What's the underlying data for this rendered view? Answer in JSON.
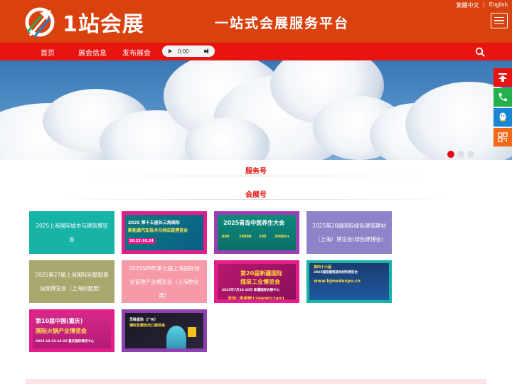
{
  "header": {
    "brand": "1站会展",
    "slogan": "一站式会展服务平台",
    "lang_traditional": "繁體中文",
    "lang_separator": "|",
    "lang_english": "English",
    "bg_color": "#d9410e"
  },
  "nav": {
    "items": [
      {
        "label": "首页"
      },
      {
        "label": "展会信息"
      },
      {
        "label": "发布展会"
      }
    ],
    "audio_time": "0:00",
    "bg_color": "#e8140f"
  },
  "banner": {
    "slide_count": 3,
    "active_slide": 1
  },
  "side_tools": [
    {
      "icon": "back-to-top-icon",
      "color": "#e8140f"
    },
    {
      "icon": "phone-icon",
      "color": "#22b14c"
    },
    {
      "icon": "qq-icon",
      "color": "#1a87d6"
    },
    {
      "icon": "qr-code-icon",
      "color": "#f26a17"
    }
  ],
  "sections": {
    "service": "服务号",
    "expo": "会展号"
  },
  "cards": [
    {
      "text": "2025上海国际城市与建筑博览会",
      "style": "teal"
    },
    {
      "image_text": [
        "2025 第十五届长三角国际",
        "新能源汽车技术与供应链博览会",
        "10.22-10.24"
      ],
      "style": "magenta-border"
    },
    {
      "image_text": [
        "2025青岛中医养生大会",
        "600",
        "20000",
        "200",
        "20000+"
      ],
      "style": "teal-image"
    },
    {
      "text": "2025第20届国际绿色建筑建材（上海）博览会(绿色建博会)",
      "style": "purple"
    },
    {
      "text": "2025第27届上海国际别墅配套设施博览会（上海别墅展）",
      "style": "olive"
    },
    {
      "text": "2025SPME第七届上海国际物业管理产业博览会（上海物业展）",
      "style": "pink"
    },
    {
      "image_text": [
        "第20届新疆国际",
        "煤炭工业博览会",
        "2025年7月18-20日 新疆国际会展中心",
        "咨询: 李颖辉13999822491"
      ],
      "style": "magenta-image"
    },
    {
      "image_text": [
        "第四十六届",
        "2025国际建筑装饰材料博览会",
        "www.bjmedexpo.cn"
      ],
      "style": "teal-image"
    },
    {
      "image_text": [
        "第10届中国(重庆)",
        "国际火锅产业博览会",
        "2025.10.23-10.25 重庆国际博览中心"
      ],
      "style": "magenta-border"
    },
    {
      "image_text": [
        "灵眸星际（广州）",
        "潮玩及模玩出口展览会"
      ],
      "style": "purple-border"
    }
  ]
}
